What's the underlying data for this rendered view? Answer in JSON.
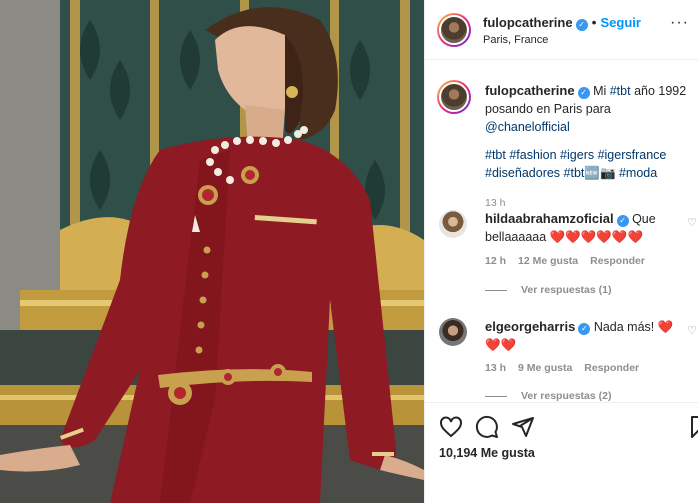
{
  "post": {
    "username": "fulopcatherine",
    "follow_label": "Seguir",
    "location": "Paris, France",
    "more_label": "···"
  },
  "caption": {
    "username": "fulopcatherine",
    "text_start": "Mi ",
    "tag1": "#tbt",
    "text_mid": " año 1992 posando en Paris para ",
    "mention": "@chanelofficial",
    "hashtags_line1": "#tbt #fashion #igers #igersfrance",
    "hashtags_line2": "#diseñadores #tbt🆕📷 #moda",
    "time": "13 h"
  },
  "comments": [
    {
      "username": "hildaabrahamzoficial",
      "text": "Que bellaaaaaa ❤️❤️❤️❤️❤️❤️",
      "time": "12 h",
      "likes": "12 Me gusta",
      "reply": "Responder",
      "view_replies": "Ver respuestas (1)"
    },
    {
      "username": "elgeorgeharris",
      "text": "Nada más! ❤️ ❤️❤️",
      "time": "13 h",
      "likes": "9 Me gusta",
      "reply": "Responder",
      "view_replies": "Ver respuestas (2)"
    }
  ],
  "actions": {
    "like_count": "10,194 Me gusta",
    "like_icon": "heart-icon",
    "comment_icon": "comment-icon",
    "share_icon": "share-icon",
    "save_icon": "bookmark-icon"
  },
  "colors": {
    "link": "#00376b",
    "follow": "#0095f6",
    "verified": "#3897f0",
    "muted": "#8e8e8e",
    "dress": "#8e1a23"
  }
}
